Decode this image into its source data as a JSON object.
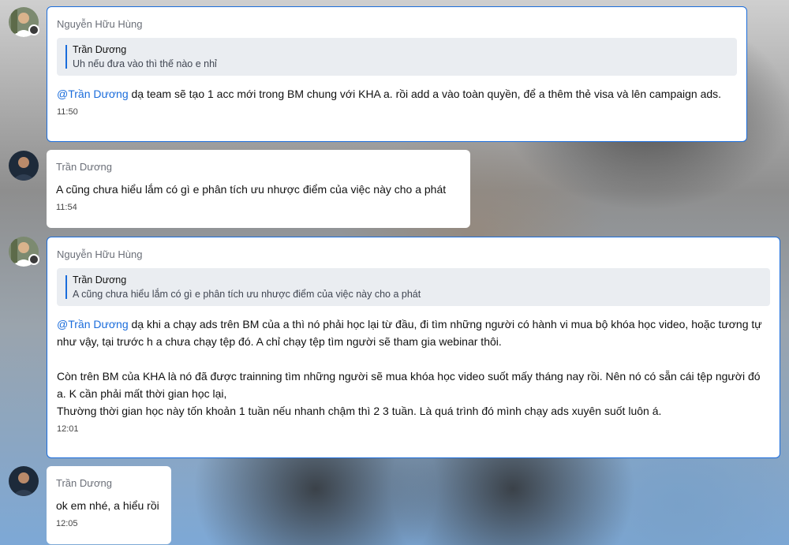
{
  "messages": [
    {
      "sender": "Nguyễn Hữu Hùng",
      "quote": {
        "name": "Trần Dương",
        "text": "Uh nếu đưa vào thì thế nào e nhỉ"
      },
      "mention": "@Trần Dương",
      "text": " dạ team sẽ tạo 1 acc mới trong BM chung với KHA a. rồi add a vào toàn quyền, để a thêm thẻ visa và lên campaign ads.",
      "time": "11:50"
    },
    {
      "sender": "Trần Dương",
      "text": "A cũng chưa hiểu lắm có gì e phân tích ưu nhược điểm của việc này cho a phát",
      "time": "11:54"
    },
    {
      "sender": "Nguyễn Hữu Hùng",
      "quote": {
        "name": "Trần Dương",
        "text": "A cũng chưa hiểu lắm có gì e phân tích ưu nhược điểm của việc này cho a phát"
      },
      "mention": "@Trần Dương",
      "text": " dạ khi a chạy ads trên BM của a thì nó phải học lại từ đầu, đi tìm những người có hành vi mua bộ khóa học video, hoặc tương tự như vậy, tại trước h a chưa chạy tệp đó. A chỉ chạy tệp tìm người sẽ tham gia webinar thôi.",
      "para2_line1": "Còn trên BM của KHA là nó đã được trainning tìm những người sẽ mua khóa học video suốt mấy tháng nay rồi. Nên nó có sẵn cái tệp người đó a. K cần phải mất thời gian học lại,",
      "para2_line2": "Thường thời gian học này tốn khoản 1 tuần nếu nhanh chậm thì 2 3 tuần. Là quá trình đó mình chạy ads xuyên suốt luôn á.",
      "time": "12:01"
    },
    {
      "sender": "Trần Dương",
      "text": "ok em nhé, a hiểu rồi",
      "time": "12:05"
    }
  ]
}
